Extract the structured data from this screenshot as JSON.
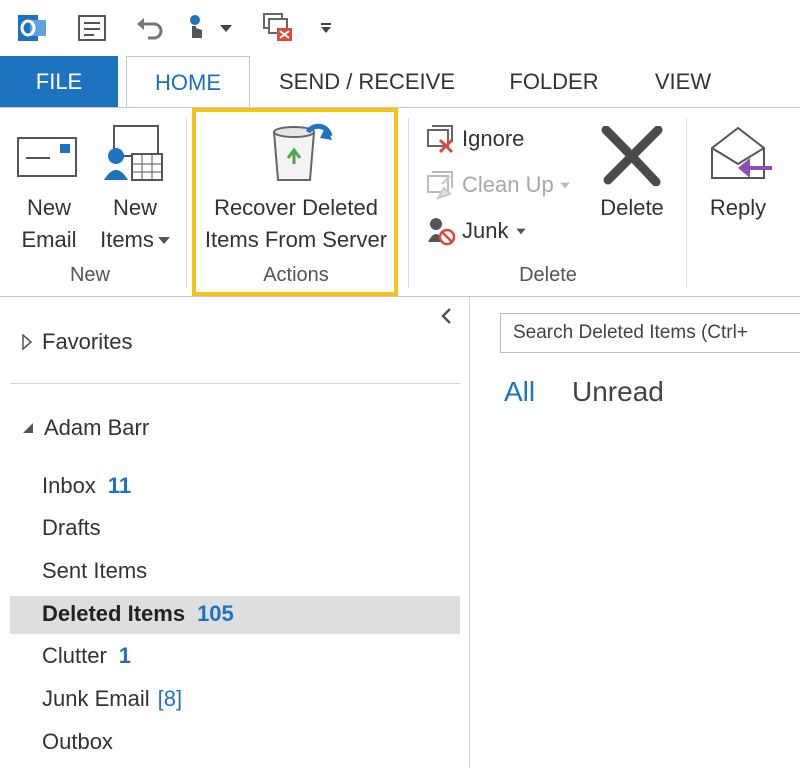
{
  "qat": {
    "icons": [
      "outlook-logo-icon",
      "send-receive-icon",
      "undo-icon",
      "touch-mode-icon",
      "delete-all-icon",
      "customize-icon"
    ]
  },
  "tabs": {
    "file": "FILE",
    "home": "HOME",
    "send_receive": "SEND / RECEIVE",
    "folder": "FOLDER",
    "view": "VIEW"
  },
  "ribbon": {
    "new_group": {
      "label": "New",
      "new_email_line1": "New",
      "new_email_line2": "Email",
      "new_items_line1": "New",
      "new_items_line2": "Items"
    },
    "actions_group": {
      "label": "Actions",
      "recover_line1": "Recover Deleted",
      "recover_line2": "Items From Server"
    },
    "delete_group": {
      "label": "Delete",
      "ignore": "Ignore",
      "clean_up": "Clean Up",
      "junk": "Junk",
      "delete": "Delete"
    },
    "respond_group": {
      "reply": "Reply"
    }
  },
  "folders": {
    "favorites": "Favorites",
    "account": "Adam Barr",
    "items": [
      {
        "name": "Inbox",
        "count": "11"
      },
      {
        "name": "Drafts",
        "count": ""
      },
      {
        "name": "Sent Items",
        "count": ""
      },
      {
        "name": "Deleted Items",
        "count": "105"
      },
      {
        "name": "Clutter",
        "count": "1"
      },
      {
        "name": "Junk Email",
        "count": "[8]"
      },
      {
        "name": "Outbox",
        "count": ""
      }
    ]
  },
  "message_list": {
    "search_placeholder": "Search Deleted Items (Ctrl+",
    "filter_all": "All",
    "filter_unread": "Unread"
  },
  "colors": {
    "accent": "#1e73be",
    "highlight_border": "#f2c419",
    "selected_row": "#dedede"
  }
}
